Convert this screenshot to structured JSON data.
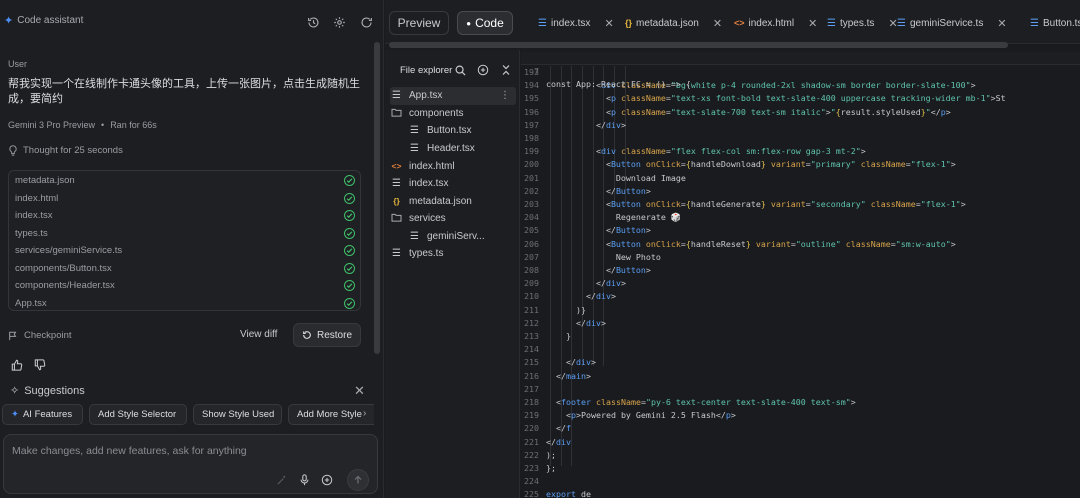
{
  "assistant": {
    "title": "Code assistant",
    "user_label": "User",
    "user_message": "帮我实现一个在线制作卡通头像的工具，上传一张图片，点击生成随机生成，要简约",
    "model": "Gemini 3 Pro Preview",
    "ran_for": "Ran for 66s",
    "thought": "Thought for 25 seconds",
    "files": [
      "metadata.json",
      "index.html",
      "index.tsx",
      "types.ts",
      "services/geminiService.ts",
      "components/Button.tsx",
      "components/Header.tsx",
      "App.tsx"
    ],
    "checkpoint_label": "Checkpoint",
    "view_diff_label": "View diff",
    "restore_label": "Restore",
    "suggestions_title": "Suggestions",
    "suggestions": [
      "AI Features",
      "Add Style Selector",
      "Show Style Used",
      "Add More Style"
    ],
    "input_placeholder": "Make changes, add new features, ask for anything"
  },
  "editor_header": {
    "preview_label": "Preview",
    "code_label": "Code",
    "tabs": [
      {
        "name": "index.tsx",
        "icon": "lines-icon"
      },
      {
        "name": "metadata.json",
        "icon": "braces-icon"
      },
      {
        "name": "index.html",
        "icon": "angle-brackets-icon"
      },
      {
        "name": "types.ts",
        "icon": "lines-icon"
      },
      {
        "name": "geminiService.ts",
        "icon": "lines-icon"
      },
      {
        "name": "Button.tsx",
        "icon": "lines-icon"
      }
    ]
  },
  "explorer": {
    "title": "File explorer",
    "items": [
      {
        "name": "App.tsx",
        "type": "file",
        "depth": 0,
        "icon": "lines-icon"
      },
      {
        "name": "components",
        "type": "folder",
        "depth": 0,
        "icon": "folder-icon"
      },
      {
        "name": "Button.tsx",
        "type": "file",
        "depth": 1,
        "icon": "lines-icon"
      },
      {
        "name": "Header.tsx",
        "type": "file",
        "depth": 1,
        "icon": "lines-icon"
      },
      {
        "name": "index.html",
        "type": "file",
        "depth": 0,
        "icon": "angle-brackets-icon"
      },
      {
        "name": "index.tsx",
        "type": "file",
        "depth": 0,
        "icon": "lines-icon"
      },
      {
        "name": "metadata.json",
        "type": "file",
        "depth": 0,
        "icon": "braces-icon"
      },
      {
        "name": "services",
        "type": "folder",
        "depth": 0,
        "icon": "folder-icon"
      },
      {
        "name": "geminiServ...",
        "type": "file",
        "depth": 1,
        "icon": "lines-icon"
      },
      {
        "name": "types.ts",
        "type": "file",
        "depth": 0,
        "icon": "lines-icon"
      }
    ]
  },
  "code": {
    "sticky": {
      "num": "7",
      "text": "const App: React.FC = () => {"
    },
    "lines": [
      {
        "num": "193",
        "text": ""
      },
      {
        "num": "194",
        "text": "          <div className=\"bg-white p-4 rounded-2xl shadow-sm border border-slate-100\">"
      },
      {
        "num": "195",
        "text": "            <p className=\"text-xs font-bold text-slate-400 uppercase tracking-wider mb-1\">St"
      },
      {
        "num": "196",
        "text": "            <p className=\"text-slate-700 text-sm italic\">\"{result.styleUsed}\"</p>"
      },
      {
        "num": "197",
        "text": "          </div>"
      },
      {
        "num": "198",
        "text": ""
      },
      {
        "num": "199",
        "text": "          <div className=\"flex flex-col sm:flex-row gap-3 mt-2\">"
      },
      {
        "num": "200",
        "text": "            <Button onClick={handleDownload} variant=\"primary\" className=\"flex-1\">"
      },
      {
        "num": "201",
        "text": "              Download Image"
      },
      {
        "num": "202",
        "text": "            </Button>"
      },
      {
        "num": "203",
        "text": "            <Button onClick={handleGenerate} variant=\"secondary\" className=\"flex-1\">"
      },
      {
        "num": "204",
        "text": "              Regenerate 🎲"
      },
      {
        "num": "205",
        "text": "            </Button>"
      },
      {
        "num": "206",
        "text": "            <Button onClick={handleReset} variant=\"outline\" className=\"sm:w-auto\">"
      },
      {
        "num": "207",
        "text": "              New Photo"
      },
      {
        "num": "208",
        "text": "            </Button>"
      },
      {
        "num": "209",
        "text": "          </div>"
      },
      {
        "num": "210",
        "text": "        </div>"
      },
      {
        "num": "211",
        "text": "      )}"
      },
      {
        "num": "212",
        "text": "      </div>"
      },
      {
        "num": "213",
        "text": "    }"
      },
      {
        "num": "214",
        "text": ""
      },
      {
        "num": "215",
        "text": "    </div>"
      },
      {
        "num": "216",
        "text": "  </main>"
      },
      {
        "num": "217",
        "text": ""
      },
      {
        "num": "218",
        "text": "  <footer className=\"py-6 text-center text-slate-400 text-sm\">"
      },
      {
        "num": "219",
        "text": "    <p>Powered by Gemini 2.5 Flash</p>"
      },
      {
        "num": "220",
        "text": "  </f"
      },
      {
        "num": "221",
        "text": "</div"
      },
      {
        "num": "222",
        "text": ");"
      },
      {
        "num": "223",
        "text": "};"
      },
      {
        "num": "224",
        "text": ""
      },
      {
        "num": "225",
        "text": "export de"
      }
    ]
  },
  "colors": {
    "accent_blue": "#4b8ff7",
    "check_green": "#3fbf6a",
    "keyword": "#5b9ef3",
    "attribute": "#d7a44c",
    "string": "#5fc4b0"
  }
}
